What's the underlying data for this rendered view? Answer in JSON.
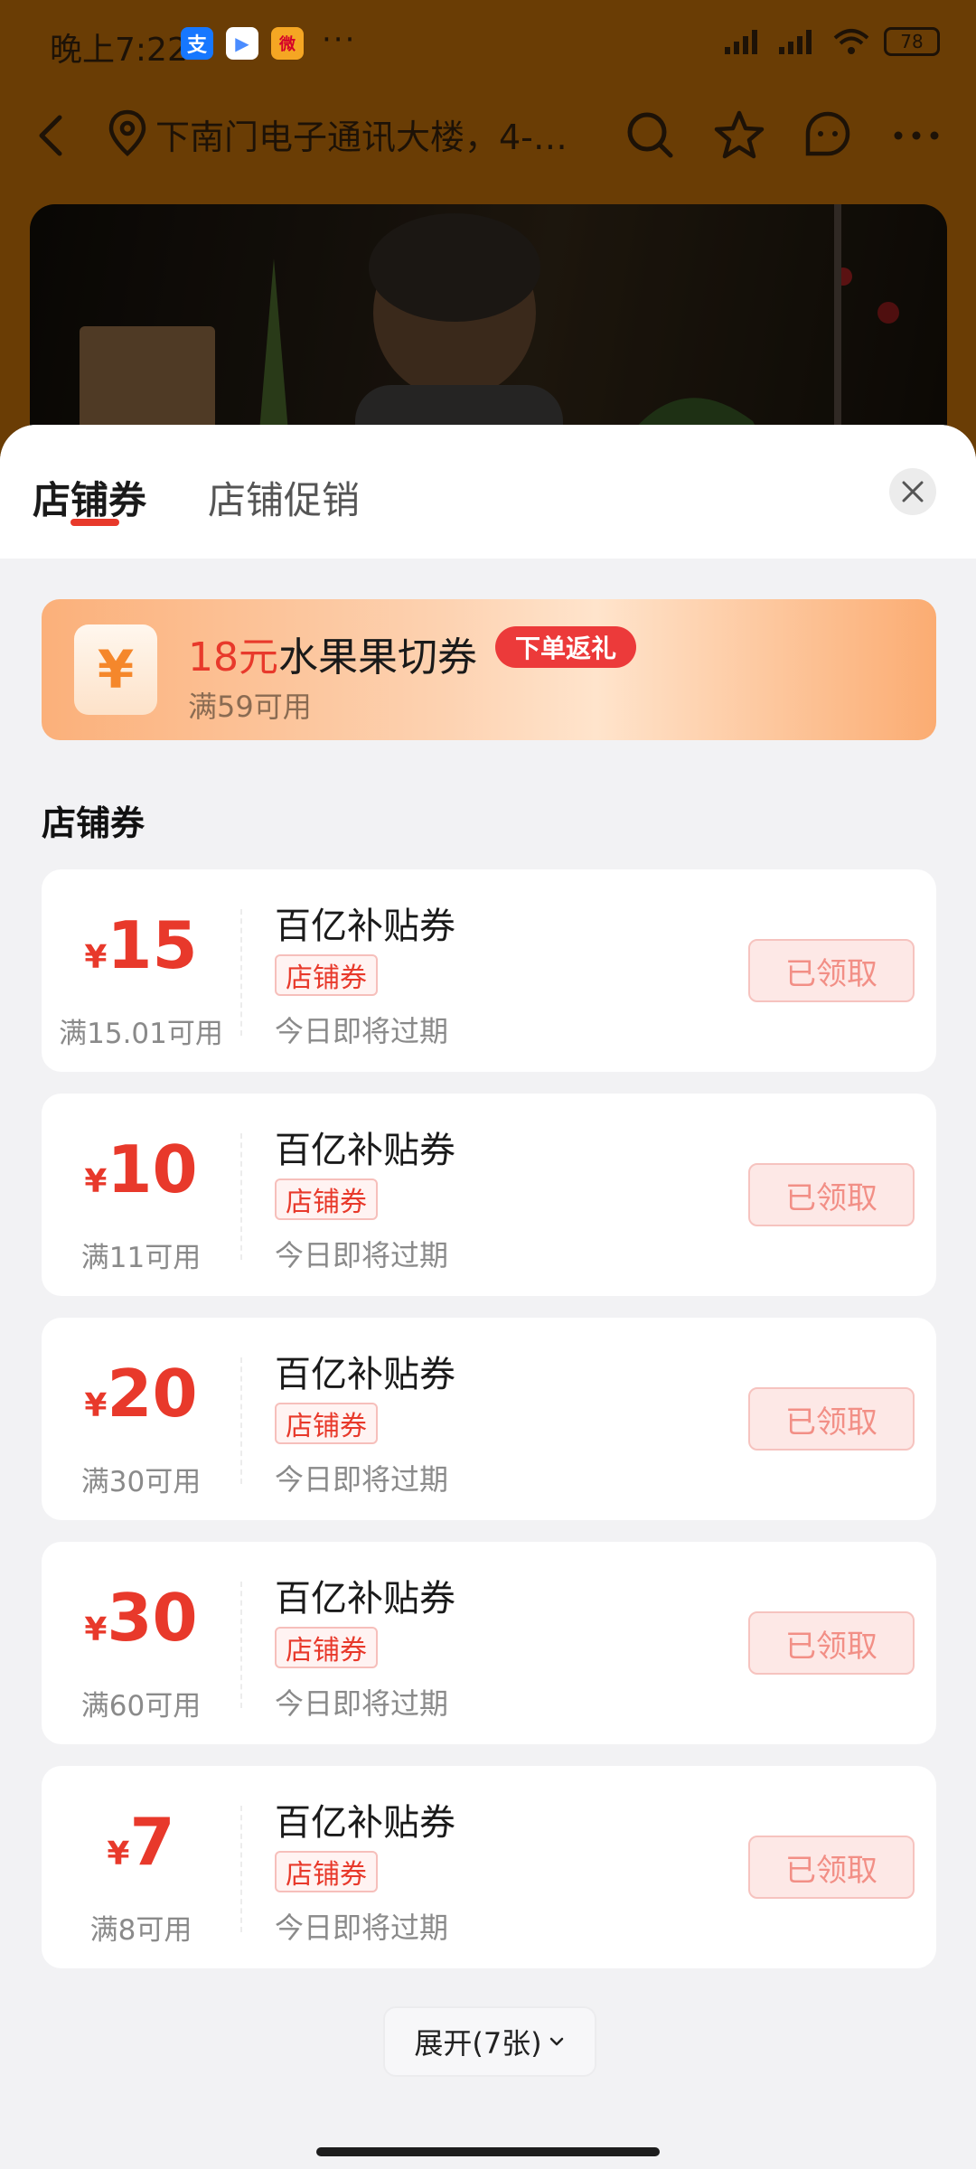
{
  "status_bar": {
    "time": "晚上7:22",
    "dots": "···",
    "battery": "78",
    "apps": [
      {
        "icon": "alipay-icon",
        "glyph": "支",
        "color": "#1677ff"
      },
      {
        "icon": "video-app-icon",
        "glyph": "▶",
        "color": "#ffffff"
      },
      {
        "icon": "weibo-icon",
        "glyph": "微",
        "color": "#f5a623"
      }
    ]
  },
  "nav": {
    "location": "下南门电子通讯大楼，4-…"
  },
  "tabs": [
    {
      "label": "店铺券"
    },
    {
      "label": "店铺促销"
    }
  ],
  "promo": {
    "amount": "18元",
    "title": "水果果切券",
    "badge": "下单返礼",
    "condition": "满59可用",
    "yen": "¥"
  },
  "section_title": "店铺券",
  "coupons": [
    {
      "yen": "¥",
      "value": "15",
      "condition": "满15.01可用",
      "name": "百亿补贴券",
      "tag": "店铺券",
      "expire": "今日即将过期",
      "button": "已领取"
    },
    {
      "yen": "¥",
      "value": "10",
      "condition": "满11可用",
      "name": "百亿补贴券",
      "tag": "店铺券",
      "expire": "今日即将过期",
      "button": "已领取"
    },
    {
      "yen": "¥",
      "value": "20",
      "condition": "满30可用",
      "name": "百亿补贴券",
      "tag": "店铺券",
      "expire": "今日即将过期",
      "button": "已领取"
    },
    {
      "yen": "¥",
      "value": "30",
      "condition": "满60可用",
      "name": "百亿补贴券",
      "tag": "店铺券",
      "expire": "今日即将过期",
      "button": "已领取"
    },
    {
      "yen": "¥",
      "value": "7",
      "condition": "满8可用",
      "name": "百亿补贴券",
      "tag": "店铺券",
      "expire": "今日即将过期",
      "button": "已领取"
    }
  ],
  "expand_label": "展开(7张)",
  "colors": {
    "accent_red": "#e8392b",
    "overlay_brown": "#6a3d05",
    "sheet_bg": "#f2f2f4"
  }
}
